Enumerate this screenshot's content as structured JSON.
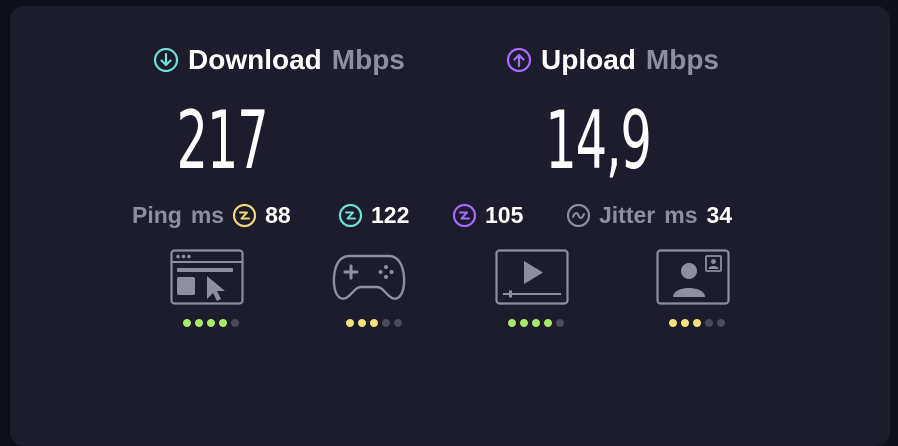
{
  "download": {
    "label": "Download",
    "unit": "Mbps",
    "value": "217",
    "color": "#6ee0d6"
  },
  "upload": {
    "label": "Upload",
    "unit": "Mbps",
    "value": "14,9",
    "color": "#a66bff"
  },
  "stats": {
    "ping_label": "Ping",
    "ping_unit": "ms",
    "ping_idle": "88",
    "ping_down": "122",
    "ping_up": "105",
    "jitter_label": "Jitter",
    "jitter_unit": "ms",
    "jitter": "34",
    "idle_color": "#f3d774",
    "down_color": "#6ee0d6",
    "up_color": "#a66bff",
    "jitter_color": "#8e8e9e"
  },
  "apps": [
    {
      "name": "web-browsing",
      "icon": "browser-cursor-icon",
      "rating": 4,
      "max": 5,
      "dot_color": "#a9ea6a"
    },
    {
      "name": "gaming",
      "icon": "gamepad-icon",
      "rating": 3,
      "max": 5,
      "dot_color": "#f6e27c"
    },
    {
      "name": "video-streaming",
      "icon": "video-player-icon",
      "rating": 4,
      "max": 5,
      "dot_color": "#a9ea6a"
    },
    {
      "name": "video-calls",
      "icon": "video-call-icon",
      "rating": 3,
      "max": 5,
      "dot_color": "#f6e27c"
    }
  ]
}
